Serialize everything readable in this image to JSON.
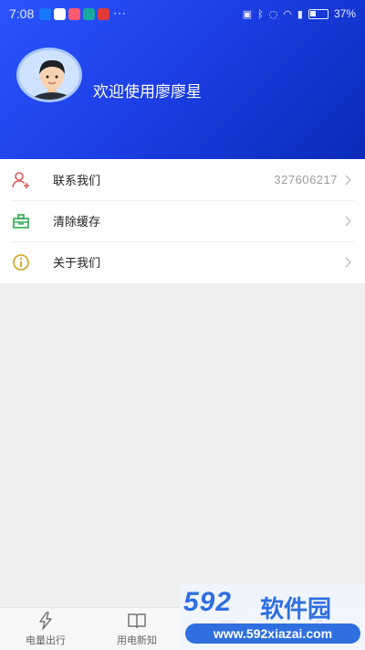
{
  "status_bar": {
    "time": "7:08",
    "notif_icons": [
      "alipay-icon",
      "cloud-icon",
      "app-icon",
      "browser-icon",
      "news-icon"
    ],
    "more": "···",
    "battery_percent": "37%"
  },
  "header": {
    "welcome_text": "欢迎使用廖廖星"
  },
  "menu": {
    "items": [
      {
        "label": "联系我们",
        "value": "327606217",
        "icon": "contact-icon"
      },
      {
        "label": "清除缓存",
        "value": "",
        "icon": "clear-cache-icon"
      },
      {
        "label": "关于我们",
        "value": "",
        "icon": "info-icon"
      }
    ]
  },
  "tabbar": {
    "tabs": [
      {
        "label": "电量出行",
        "icon": "lightning-icon"
      },
      {
        "label": "用电新知",
        "icon": "book-icon"
      },
      {
        "label": "",
        "icon": "tab3-icon"
      },
      {
        "label": "",
        "icon": "profile-icon"
      }
    ]
  },
  "watermark": {
    "logo": "592",
    "brand": "软件园",
    "url": "www.592xiazai.com"
  },
  "colors": {
    "header_gradient": [
      "#2a55ff",
      "#0b2bb8"
    ],
    "contact_icon": "#e15b5b",
    "cache_icon": "#2fa84f",
    "info_icon": "#d4a019"
  }
}
